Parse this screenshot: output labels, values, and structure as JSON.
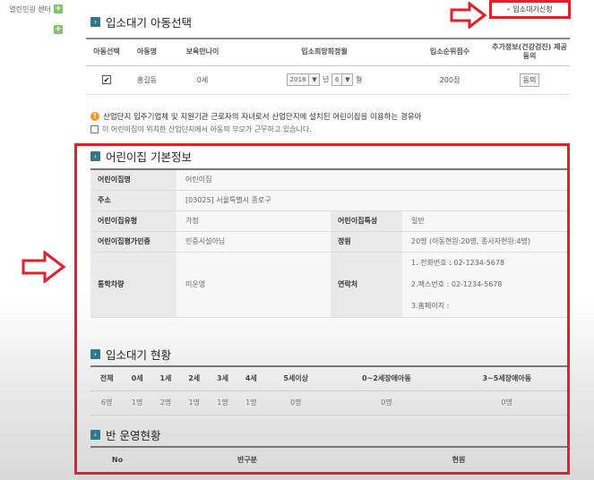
{
  "leftnav": {
    "item1_label": "열린민원 센터"
  },
  "colors": {
    "highlight_red": "#e0202a",
    "section_icon": "#2e7a8a",
    "warning_orange": "#f09a1c",
    "plus_green": "#7fc46a"
  },
  "section1": {
    "title": "입소대기 아동선택",
    "add_button_label": "입소대기신청",
    "headers": [
      "아동선택",
      "아동명",
      "보육만나이",
      "입소희망희정월",
      "입소순위점수",
      "추가정보(건강검진) 제공동의"
    ],
    "row": {
      "checked": "✔",
      "name": "홍길동",
      "age": "0세",
      "year": "2018",
      "year_unit": "년",
      "month": "6",
      "month_unit": "월",
      "score": "200점",
      "agree_label": "동의"
    }
  },
  "notice": {
    "line1": "산업단지 입주기업체 및 지원기관 근로자의 자녀로서 산업단지에 설치된 어린이집을 이용하는 경유아",
    "line2": "이 어린이집이 위치한 산업단지에서 아동의 부모가 근무하고 있습니다."
  },
  "section2": {
    "title": "어린이집 기본정보",
    "labels": {
      "name": "어린이집명",
      "address": "주소",
      "type": "어린이집유형",
      "feature": "어린이집특성",
      "eval": "어린이집평가인증",
      "capacity": "정원",
      "vehicle": "통학차량",
      "contact": "연락처"
    },
    "values": {
      "name": "어린이집",
      "address": "[03025] 서울특별시 종로구",
      "type": "가정",
      "feature": "일반",
      "eval": "인증시설아님",
      "capacity": "20명 (아동현원:20명, 종사자현원:4명)",
      "vehicle": "미운영",
      "contact_phone": "1. 전화번호 :  02-1234-5678",
      "contact_fax": "2.팩스번호 :  02-1234-5678",
      "contact_home": "3.홈페이지 :"
    }
  },
  "section3": {
    "title": "입소대기 현황",
    "headers": [
      "전체",
      "0세",
      "1세",
      "2세",
      "3세",
      "4세",
      "5세이상",
      "0~2세장애아동",
      "3~5세장애아동"
    ],
    "values": [
      "6명",
      "1명",
      "2명",
      "1명",
      "1명",
      "1명",
      "0명",
      "0명",
      "0명"
    ]
  },
  "section4": {
    "title": "반 운영현황",
    "headers": [
      "No",
      "반구분",
      "현원"
    ]
  }
}
